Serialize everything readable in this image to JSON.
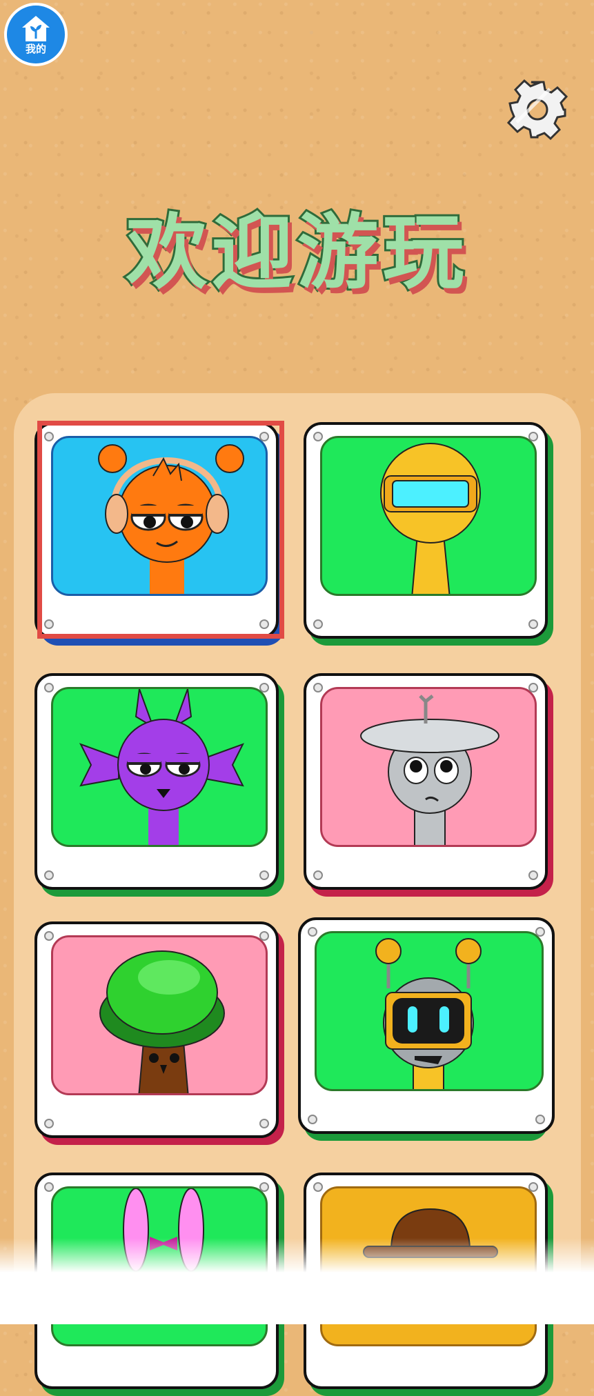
{
  "header": {
    "home_badge_label": "我的",
    "title": "欢迎游玩"
  },
  "colors": {
    "background": "#eab777",
    "panel": "#f5d0a0",
    "title_fill": "#9fe0a8",
    "title_outline": "#2f6b3a",
    "title_shadow": "#d25552",
    "selection": "#e14b45"
  },
  "cards": [
    {
      "character": "orange-headphones-character",
      "bg": "#27c3f2",
      "shadow": "#1f4fb4",
      "selected": true
    },
    {
      "character": "yellow-visor-character",
      "bg": "#1fe85a",
      "shadow": "#1c9a3a",
      "selected": false
    },
    {
      "character": "purple-horned-character",
      "bg": "#1fe85a",
      "shadow": "#1c9a3a",
      "selected": false
    },
    {
      "character": "gray-dish-character",
      "bg": "#ff9bb5",
      "shadow": "#c4214a",
      "selected": false
    },
    {
      "character": "tree-character",
      "bg": "#ff9bb5",
      "shadow": "#c4214a",
      "selected": false
    },
    {
      "character": "robot-character",
      "bg": "#1fe85a",
      "shadow": "#1c9a3a",
      "selected": false
    },
    {
      "character": "pink-bunny-character",
      "bg": "#1fe85a",
      "shadow": "#1c9a3a",
      "selected": false
    },
    {
      "character": "brown-hat-character",
      "bg": "#f2b21e",
      "shadow": "#1c9a3a",
      "selected": false
    }
  ]
}
